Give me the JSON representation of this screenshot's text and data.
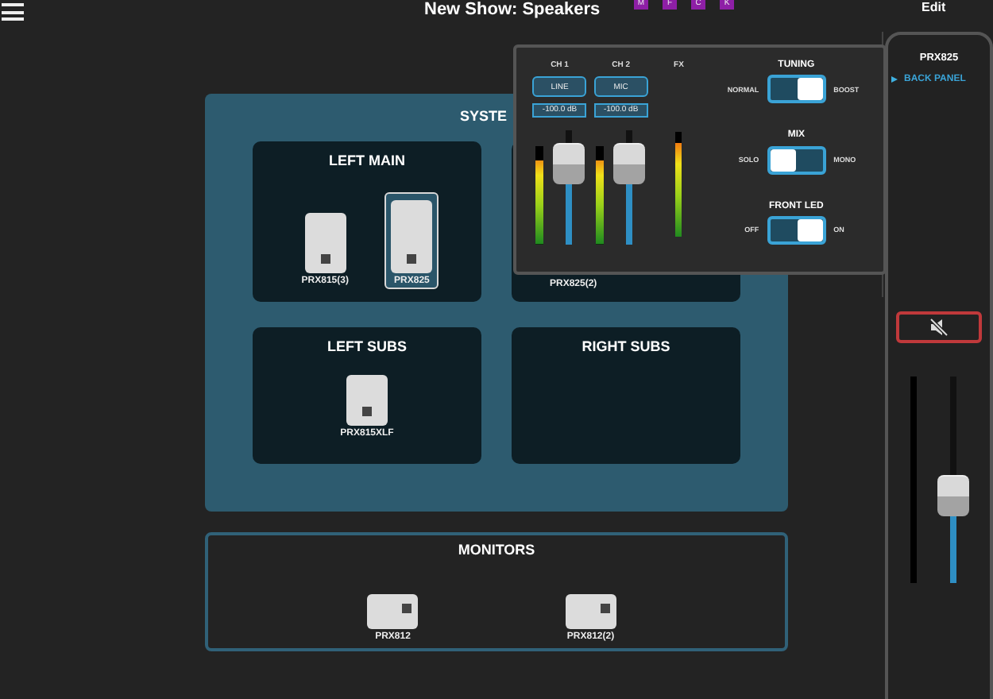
{
  "top_bar": {
    "title": "New Show: Speakers",
    "badges": [
      "M",
      "F",
      "C",
      "K"
    ],
    "edit": "Edit"
  },
  "system": {
    "title": "SYSTE",
    "zones": [
      {
        "title": "LEFT MAIN",
        "speakers": [
          {
            "name": "PRX815(3)",
            "kind": "tall",
            "selected": false
          },
          {
            "name": "PRX825",
            "kind": "tall",
            "selected": true
          }
        ]
      },
      {
        "speakers": [
          {
            "name": "PRX825(2)",
            "selected": false
          }
        ]
      },
      {
        "title": "LEFT SUBS",
        "speakers": [
          {
            "name": "PRX815XLF",
            "kind": "sub",
            "selected": false
          }
        ]
      },
      {
        "title": "RIGHT SUBS"
      }
    ]
  },
  "monitors": {
    "title": "MONITORS",
    "speakers": [
      {
        "name": "PRX812",
        "kind": "wedge",
        "selected": false
      },
      {
        "name": "PRX812(2)",
        "kind": "wedge",
        "selected": false
      }
    ]
  },
  "popup": {
    "channels": [
      {
        "label": "CH 1",
        "button": "LINE",
        "reading": "-100.0 dB",
        "meter": {
          "level": 0.85
        },
        "fader": {
          "level": 0.82
        }
      },
      {
        "label": "CH 2",
        "button": "MIC",
        "reading": "-100.0 dB",
        "meter": {
          "level": 0.85
        },
        "fader": {
          "level": 0.82
        }
      }
    ],
    "fx": {
      "label": "FX",
      "meter": {
        "level": 0.9
      }
    },
    "switches": [
      {
        "title": "TUNING",
        "left": "NORMAL",
        "right": "BOOST",
        "on": true
      },
      {
        "title": "MIX",
        "left": "SOLO",
        "right": "MONO",
        "on": false
      },
      {
        "title": "FRONT LED",
        "left": "OFF",
        "right": "ON",
        "on": true
      }
    ]
  },
  "side_panel": {
    "title": "PRX825",
    "link": "BACK PANEL",
    "mute": {
      "muted": true
    },
    "meter": {
      "level": 0
    },
    "fader": {
      "level": 0.4
    }
  }
}
